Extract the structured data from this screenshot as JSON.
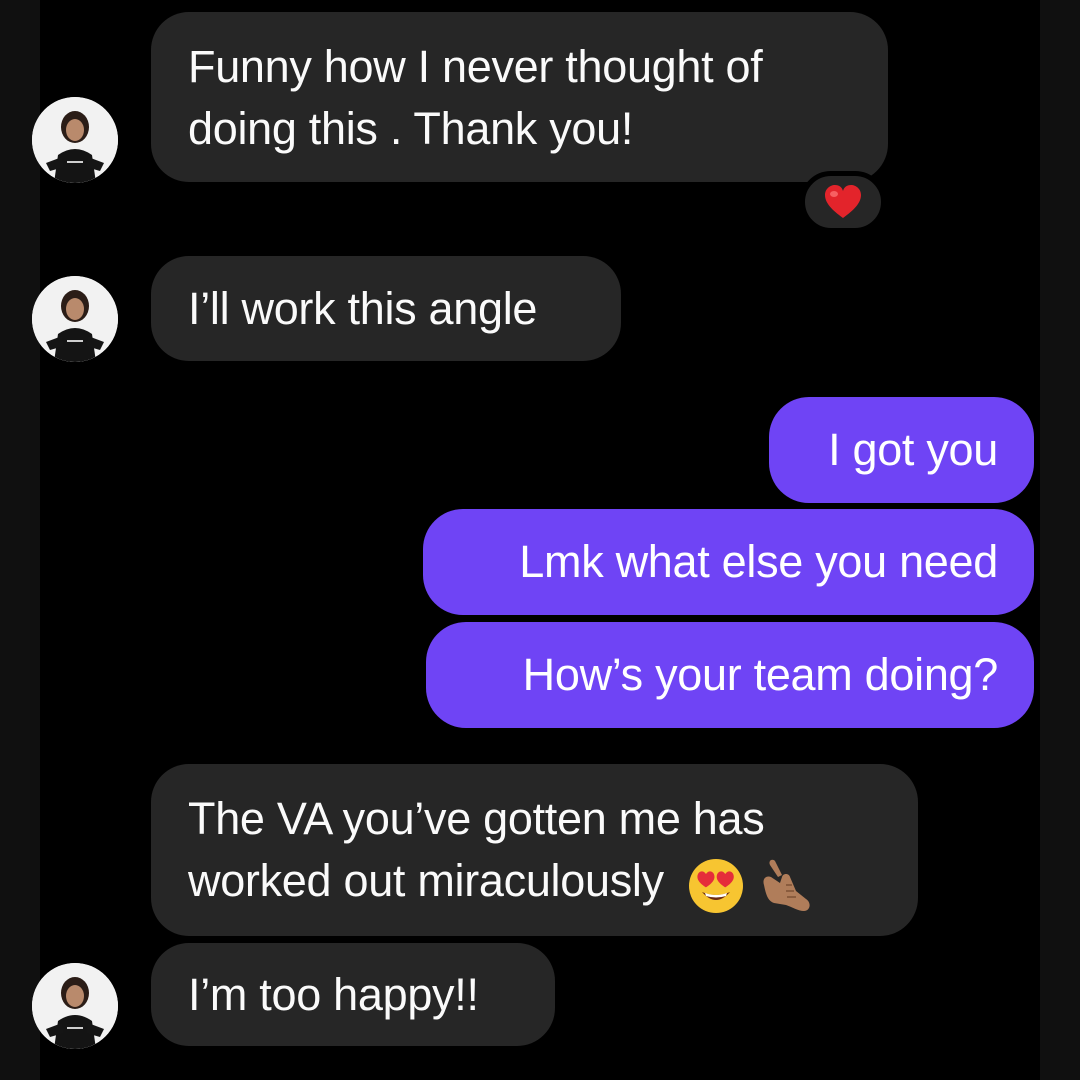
{
  "conversation": {
    "messages": [
      {
        "direction": "incoming",
        "lines": [
          "Funny how I never thought of",
          "doing this . Thank you!"
        ],
        "reaction": "red-heart"
      },
      {
        "direction": "incoming",
        "lines": [
          "I’ll work this angle"
        ]
      },
      {
        "direction": "outgoing",
        "lines": [
          "I got you"
        ]
      },
      {
        "direction": "outgoing",
        "lines": [
          "Lmk what else you need"
        ]
      },
      {
        "direction": "outgoing",
        "lines": [
          "How’s your team doing?"
        ]
      },
      {
        "direction": "incoming",
        "lines": [
          "The VA you’ve gotten me has",
          "worked out miraculously"
        ],
        "emoji": [
          "smiling-face-with-heart-eyes",
          "call-me-hand"
        ]
      },
      {
        "direction": "incoming",
        "lines": [
          "I’m too happy!!"
        ]
      }
    ]
  },
  "colors": {
    "background": "#000000",
    "incoming_bubble": "#262626",
    "outgoing_bubble": "#6f44f5",
    "text": "#ffffff"
  },
  "icons": {
    "reaction": "heart-reaction-icon",
    "avatar": "contact-avatar-icon",
    "emoji_heart_eyes": "heart-eyes-emoji-icon",
    "emoji_call_me": "call-me-hand-emoji-icon"
  }
}
